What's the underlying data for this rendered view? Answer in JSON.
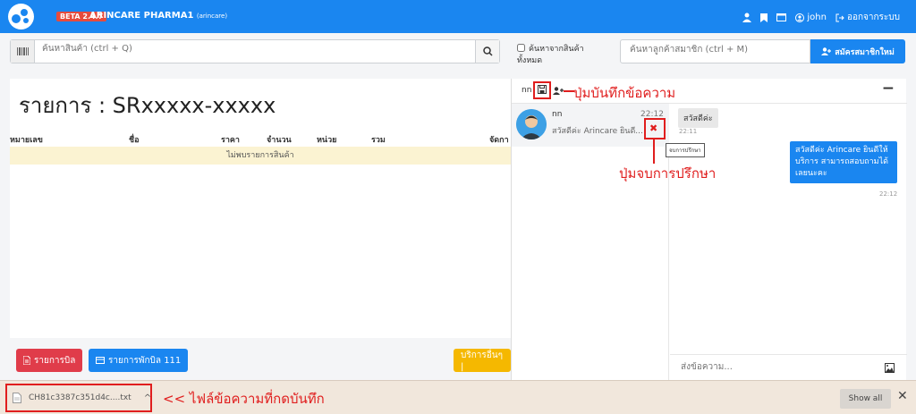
{
  "app": {
    "beta_badge": "BETA 2.4.7",
    "title": "ARINCARE PHARMA1",
    "subtitle": "(arincare)",
    "user": "john",
    "logout": "ออกจากระบบ"
  },
  "search": {
    "product_placeholder": "ค้นหาสินค้า (ctrl + Q)",
    "search_all_label": "ค้นหาจากสินค้าทั้งหมด",
    "search_all_line1": "ค้นหาจากสินค้า",
    "search_all_line2": "ทั้งหมด",
    "member_placeholder": "ค้นหาลูกค้าสมาชิก (ctrl + M)",
    "register_label": "สมัครสมาชิกใหม่"
  },
  "order": {
    "title": "รายการ : SRxxxxx-xxxxx",
    "columns": [
      "หมายเลข",
      "ชื่อ",
      "ราคา",
      "จำนวน",
      "หน่วย",
      "รวม",
      "จัดกา"
    ],
    "empty_text": "ไม่พบรายการสินค้า"
  },
  "actions": {
    "bills_label": "รายการบิล",
    "held_bills_label": "รายการพักบิล 111",
    "other_services_label": "บริการอื่นๆ |"
  },
  "chat": {
    "header_name": "nn",
    "minimize": "−",
    "conversation": {
      "name": "nn",
      "time": "22:12",
      "preview": "สวัสดีค่ะ Arincare ยินดี..."
    },
    "messages": [
      {
        "text": "สวัสดีค่ะ",
        "time": "22:11",
        "direction": "in"
      },
      {
        "text": "สวัสดีค่ะ Arincare ยินดีให้บริการ สามารถสอบถามได้เลยนะคะ",
        "time": "22:12",
        "direction": "out"
      }
    ],
    "tooltip": "จบการปรึกษา",
    "composer_placeholder": "ส่งข้อความ..."
  },
  "annotations": {
    "save_label": "ปุ่มบันทึกข้อความ",
    "end_label": "ปุ่มจบการปรึกษา",
    "file_label": "<< ไฟล์ข้อความที่กดบันทึก",
    "color": "#e01e1e"
  },
  "downloads": {
    "filename": "CH81c3387c351d4c....txt",
    "show_all": "Show all",
    "close": "✕"
  },
  "colors": {
    "primary": "#1a86f0",
    "danger": "#e03c4a",
    "warning": "#f5b800"
  }
}
